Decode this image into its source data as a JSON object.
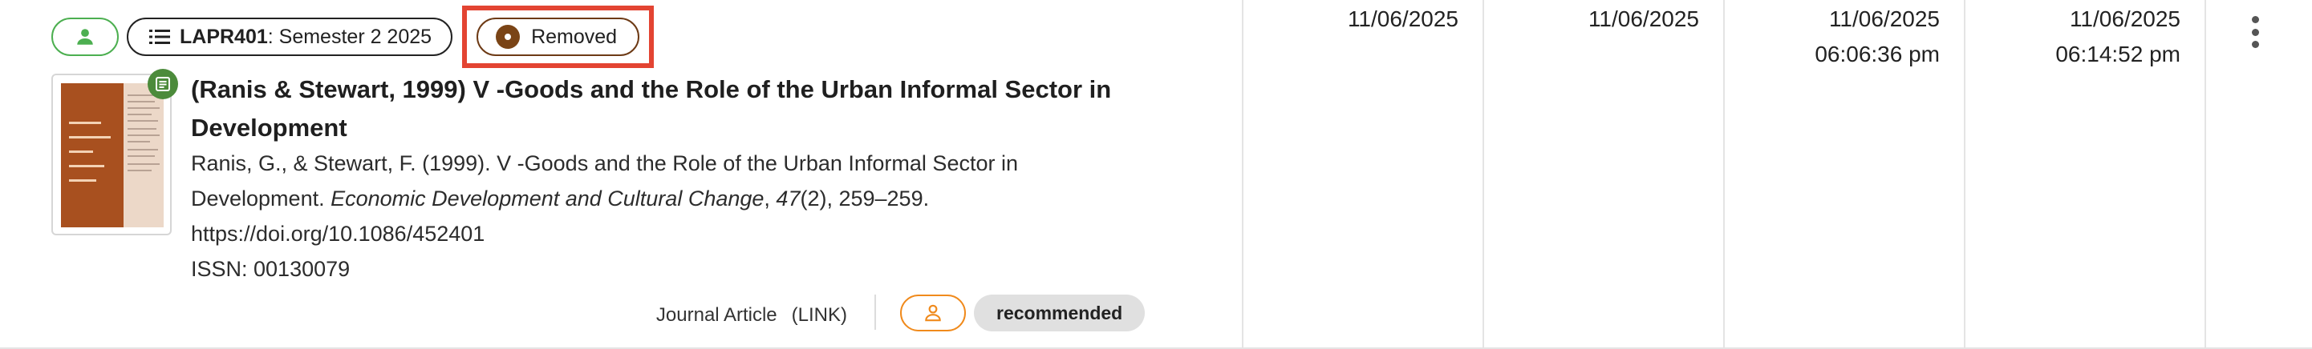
{
  "row": {
    "chips": {
      "list_code": "LAPR401",
      "list_period": ": Semester 2 2025",
      "status": "Removed"
    },
    "title": "(Ranis & Stewart, 1999) V -Goods and the Role of the Urban Informal Sector in Development",
    "citation": {
      "line1": "Ranis, G., & Stewart, F. (1999). V -Goods and the Role of the Urban Informal Sector in",
      "line2_prefix": "Development. ",
      "journal": "Economic Development and Cultural Change",
      "sep1": ", ",
      "volume": "47",
      "rest": "(2), 259–259.",
      "doi": "https://doi.org/10.1086/452401",
      "issn": "ISSN: 00130079"
    },
    "footer": {
      "type": "Journal Article",
      "link": "(LINK)",
      "tag": "recommended"
    },
    "dates": [
      {
        "date": "11/06/2025",
        "time": ""
      },
      {
        "date": "11/06/2025",
        "time": ""
      },
      {
        "date": "11/06/2025",
        "time": "06:06:36 pm"
      },
      {
        "date": "11/06/2025",
        "time": "06:14:52 pm"
      }
    ]
  },
  "colors": {
    "user_chip": "#4caf50",
    "status_highlight": "#e34432",
    "status_dot": "#7a4416",
    "badge": "#4c8b3b",
    "rec_user_chip": "#f08a1c",
    "tag_bg": "#e0e0e0"
  },
  "icons": {
    "user_chip": "person-icon",
    "list_chip": "list-icon",
    "status_chip": "status-dot-icon",
    "thumbnail_badge": "document-icon",
    "footer_chip": "person-outline-icon",
    "menu": "more-vertical-icon"
  }
}
